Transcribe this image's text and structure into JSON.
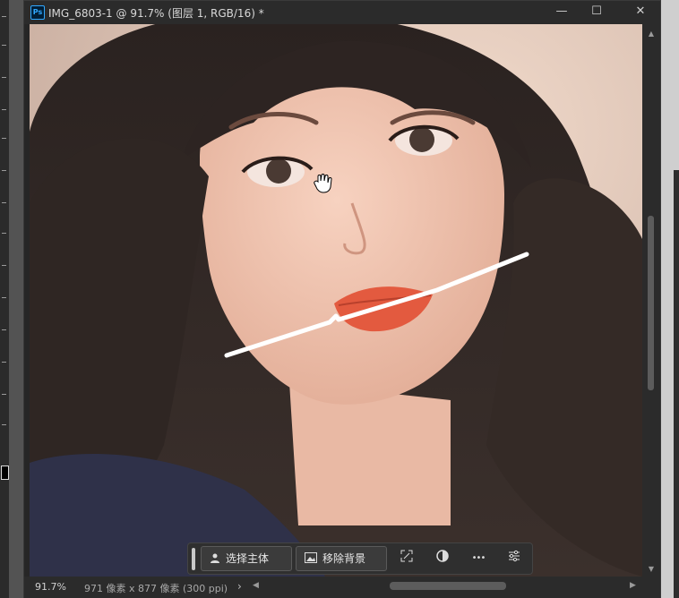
{
  "window": {
    "title": "IMG_6803-1 @ 91.7% (图层 1, RGB/16) *",
    "app_icon": "Ps",
    "controls": {
      "minimize": "—",
      "maximize": "☐",
      "close": "✕"
    }
  },
  "status": {
    "zoom": "91.7%",
    "doc_info": "971 像素 x 877 像素 (300 ppi)",
    "arrow": "›"
  },
  "context_bar": {
    "select_subject": "选择主体",
    "remove_background": "移除背景",
    "more": "•••",
    "icons": [
      "person-icon",
      "image-icon",
      "transform-icon",
      "adjustment-icon",
      "more-icon",
      "settings-icon"
    ]
  },
  "colors": {
    "ps_blue": "#31a8ff",
    "chrome": "#2b2b2b",
    "canvas_bg": "#262626"
  }
}
